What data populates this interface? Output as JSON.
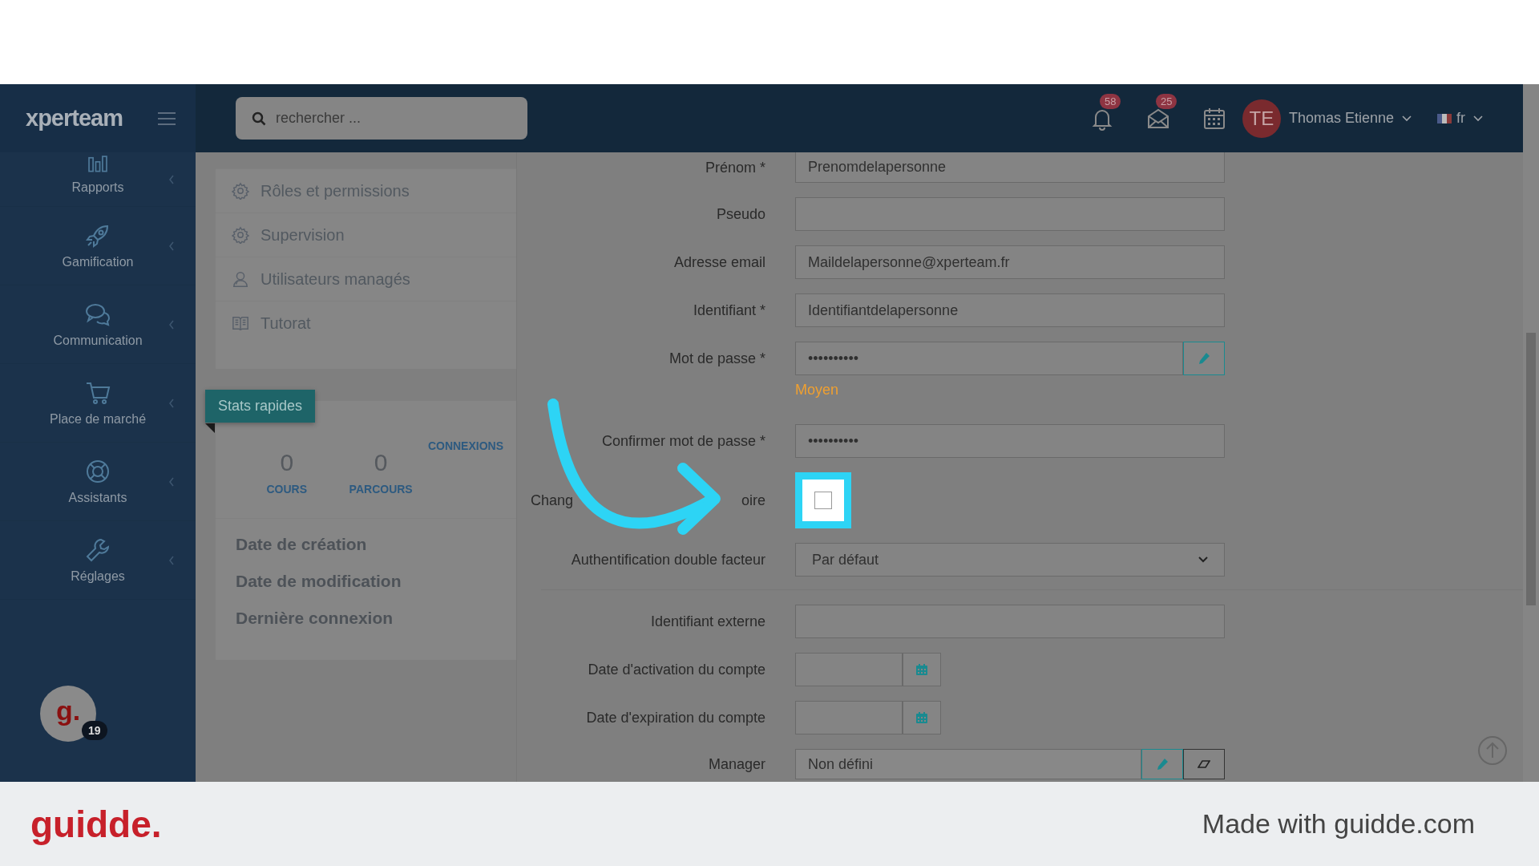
{
  "brand": {
    "logo": "xperteam"
  },
  "search": {
    "placeholder": "rechercher ..."
  },
  "header": {
    "notifications": "58",
    "messages": "25",
    "user": {
      "initials": "TE",
      "name": "Thomas Etienne"
    },
    "language": "fr"
  },
  "sidebar": {
    "items": [
      {
        "kind": "chart",
        "label": "Rapports"
      },
      {
        "kind": "rocket",
        "label": "Gamification"
      },
      {
        "kind": "chat",
        "label": "Communication"
      },
      {
        "kind": "cart",
        "label": "Place de marché"
      },
      {
        "kind": "lifebuoy",
        "label": "Assistants"
      },
      {
        "kind": "wrench",
        "label": "Réglages"
      }
    ],
    "helper": {
      "logo": "g.",
      "badge": "19"
    }
  },
  "profile_menu": [
    {
      "kind": "gear",
      "label": "Rôles et permissions"
    },
    {
      "kind": "gear",
      "label": "Supervision"
    },
    {
      "kind": "users",
      "label": "Utilisateurs managés"
    },
    {
      "kind": "book",
      "label": "Tutorat"
    }
  ],
  "stats": {
    "ribbon": "Stats rapides",
    "counters": [
      {
        "value": "0",
        "label": "COURS"
      },
      {
        "value": "0",
        "label": "PARCOURS"
      }
    ],
    "link": "CONNEXIONS",
    "dates": [
      "Date de création",
      "Date de modification",
      "Dernière connexion"
    ]
  },
  "form": {
    "fields": [
      {
        "kind": "text",
        "label": "Prénom *",
        "value": "Prenomdelapersonne"
      },
      {
        "kind": "text",
        "label": "Pseudo"
      },
      {
        "kind": "text",
        "label": "Adresse email",
        "value": "Maildelapersonne@xperteam.fr"
      },
      {
        "kind": "text",
        "label": "Identifiant *",
        "value": "Identifiantdelapersonne"
      },
      {
        "kind": "password",
        "label": "Mot de passe *",
        "value": "••••••••••",
        "strength": "Moyen"
      },
      {
        "kind": "confirm",
        "label": "Confirmer mot de passe *",
        "value": "••••••••••"
      },
      {
        "kind": "checkbox",
        "label_start": "Chang",
        "label_end": "oire",
        "checked": false
      },
      {
        "kind": "select",
        "label": "Authentification double facteur",
        "value": "Par défaut"
      },
      {
        "kind": "divider"
      },
      {
        "kind": "text",
        "label": "Identifiant externe"
      },
      {
        "kind": "date",
        "label": "Date d'activation du compte"
      },
      {
        "kind": "date",
        "label": "Date d'expiration du compte"
      },
      {
        "kind": "manager",
        "label": "Manager",
        "value": "Non défini"
      }
    ]
  },
  "footer": {
    "logo": "guidde.",
    "credit": "Made with guidde.com"
  }
}
